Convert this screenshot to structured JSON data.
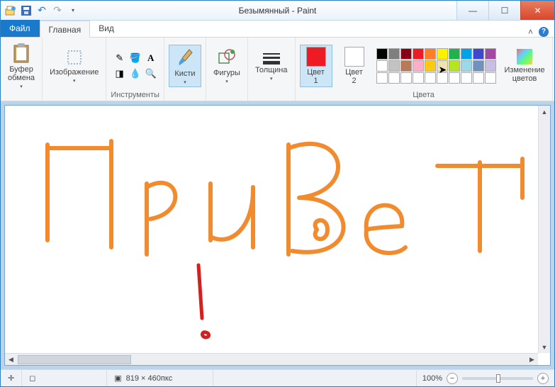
{
  "title": "Безымянный - Paint",
  "tabs": {
    "file": "Файл",
    "home": "Главная",
    "view": "Вид"
  },
  "groups": {
    "clipboard": {
      "label": "Буфер\nобмена",
      "section": ""
    },
    "image": {
      "label": "Изображение",
      "section": ""
    },
    "tools": {
      "section": "Инструменты"
    },
    "brushes": {
      "label": "Кисти"
    },
    "shapes": {
      "label": "Фигуры"
    },
    "thickness": {
      "label": "Толщина"
    },
    "color1": {
      "label": "Цвет\n1"
    },
    "color2": {
      "label": "Цвет\n2"
    },
    "colors_section": "Цвета",
    "editcolors": {
      "label": "Изменение\nцветов"
    }
  },
  "palette_colors": [
    "#000000",
    "#7f7f7f",
    "#880015",
    "#ed1c24",
    "#ff7f27",
    "#fff200",
    "#22b14c",
    "#00a2e8",
    "#3f48cc",
    "#a349a4",
    "#ffffff",
    "#c3c3c3",
    "#b97a57",
    "#ffaec9",
    "#ffc90e",
    "#efe4b0",
    "#b5e61d",
    "#99d9ea",
    "#7092be",
    "#c8bfe7",
    "#ffffff",
    "#ffffff",
    "#ffffff",
    "#ffffff",
    "#ffffff",
    "#ffffff",
    "#ffffff",
    "#ffffff",
    "#ffffff",
    "#ffffff"
  ],
  "status": {
    "canvas_size": "819 × 460пкс",
    "zoom": "100%"
  },
  "color1_value": "#ed1c24",
  "color2_value": "#ffffff"
}
